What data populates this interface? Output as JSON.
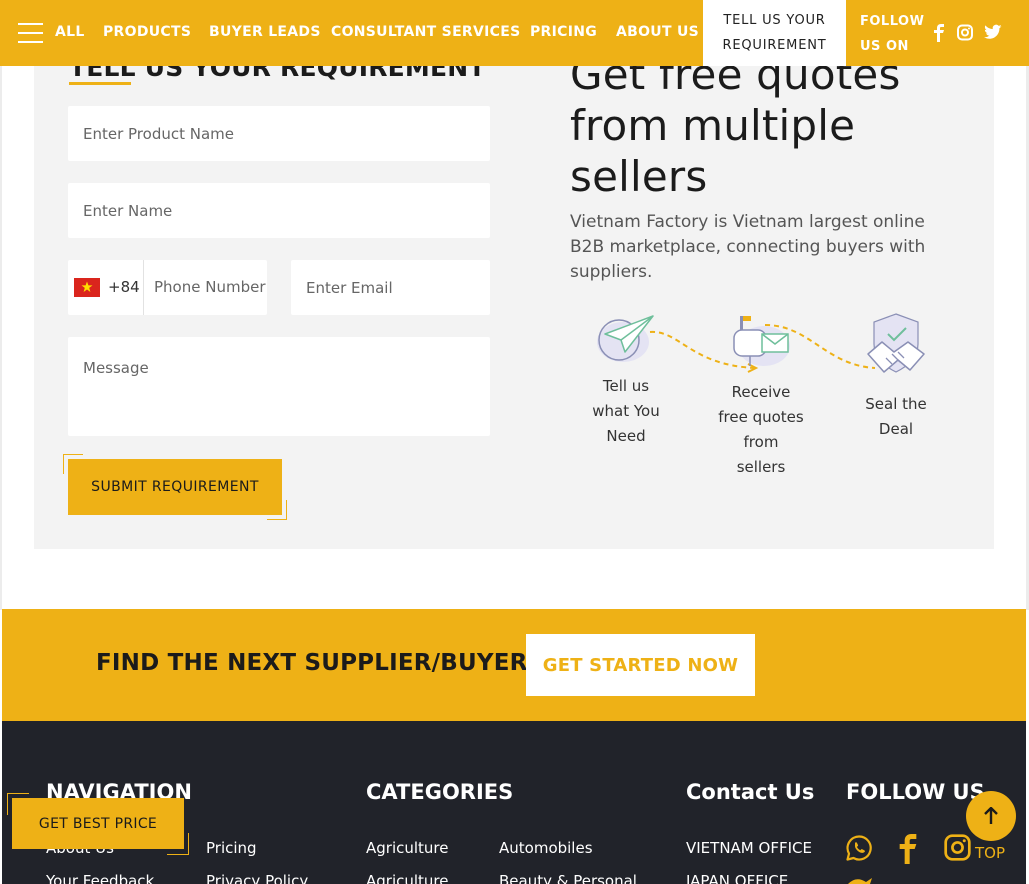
{
  "nav": {
    "all": "ALL",
    "products": "PRODUCTS",
    "buyer_leads": "BUYER LEADS",
    "consultant_services": "CONSULTANT SERVICES",
    "pricing": "PRICING",
    "about_us": "ABOUT US",
    "requirement_line1": "TELL US YOUR",
    "requirement_line2": "REQUIREMENT",
    "follow_line1": "FOLLOW",
    "follow_line2": "US ON"
  },
  "form": {
    "title": "TELL US YOUR REQUIREMENT",
    "product_placeholder": "Enter Product Name",
    "name_placeholder": "Enter Name",
    "dial_code": "+84",
    "phone_placeholder": "Phone Number",
    "email_placeholder": "Enter Email",
    "message_placeholder": "Message",
    "submit_label": "SUBMIT REQUIREMENT"
  },
  "quotes": {
    "heading": "Get free quotes from multiple sellers",
    "description": "Vietnam Factory is Vietnam largest online B2B marketplace, connecting buyers with suppliers.",
    "steps": [
      {
        "line1": "Tell us",
        "line2": "what You",
        "line3": "Need"
      },
      {
        "line1": "Receive",
        "line2": "free quotes",
        "line3": "from",
        "line4": "sellers"
      },
      {
        "line1": "Seal the",
        "line2": "Deal"
      }
    ]
  },
  "cta": {
    "text": "FIND THE NEXT SUPPLIER/BUYER",
    "button": "GET STARTED NOW"
  },
  "footer": {
    "navigation_heading": "NAVIGATION",
    "categories_heading": "CATEGORIES",
    "contact_heading": "Contact Us",
    "follow_heading": "FOLLOW US",
    "nav_links": [
      "About Us",
      "Pricing",
      "Your Feedback",
      "Privacy Policy"
    ],
    "category_links": [
      "Agriculture",
      "Automobiles",
      "Agriculture",
      "Beauty & Personal"
    ],
    "contact_links": [
      "VIETNAM OFFICE",
      "JAPAN OFFICE"
    ]
  },
  "floating": {
    "best_price": "GET BEST PRICE",
    "top_label": "TOP"
  },
  "colors": {
    "brand_yellow": "#eeb116",
    "footer_dark": "#21232a",
    "card_bg": "#f3f3f3"
  }
}
